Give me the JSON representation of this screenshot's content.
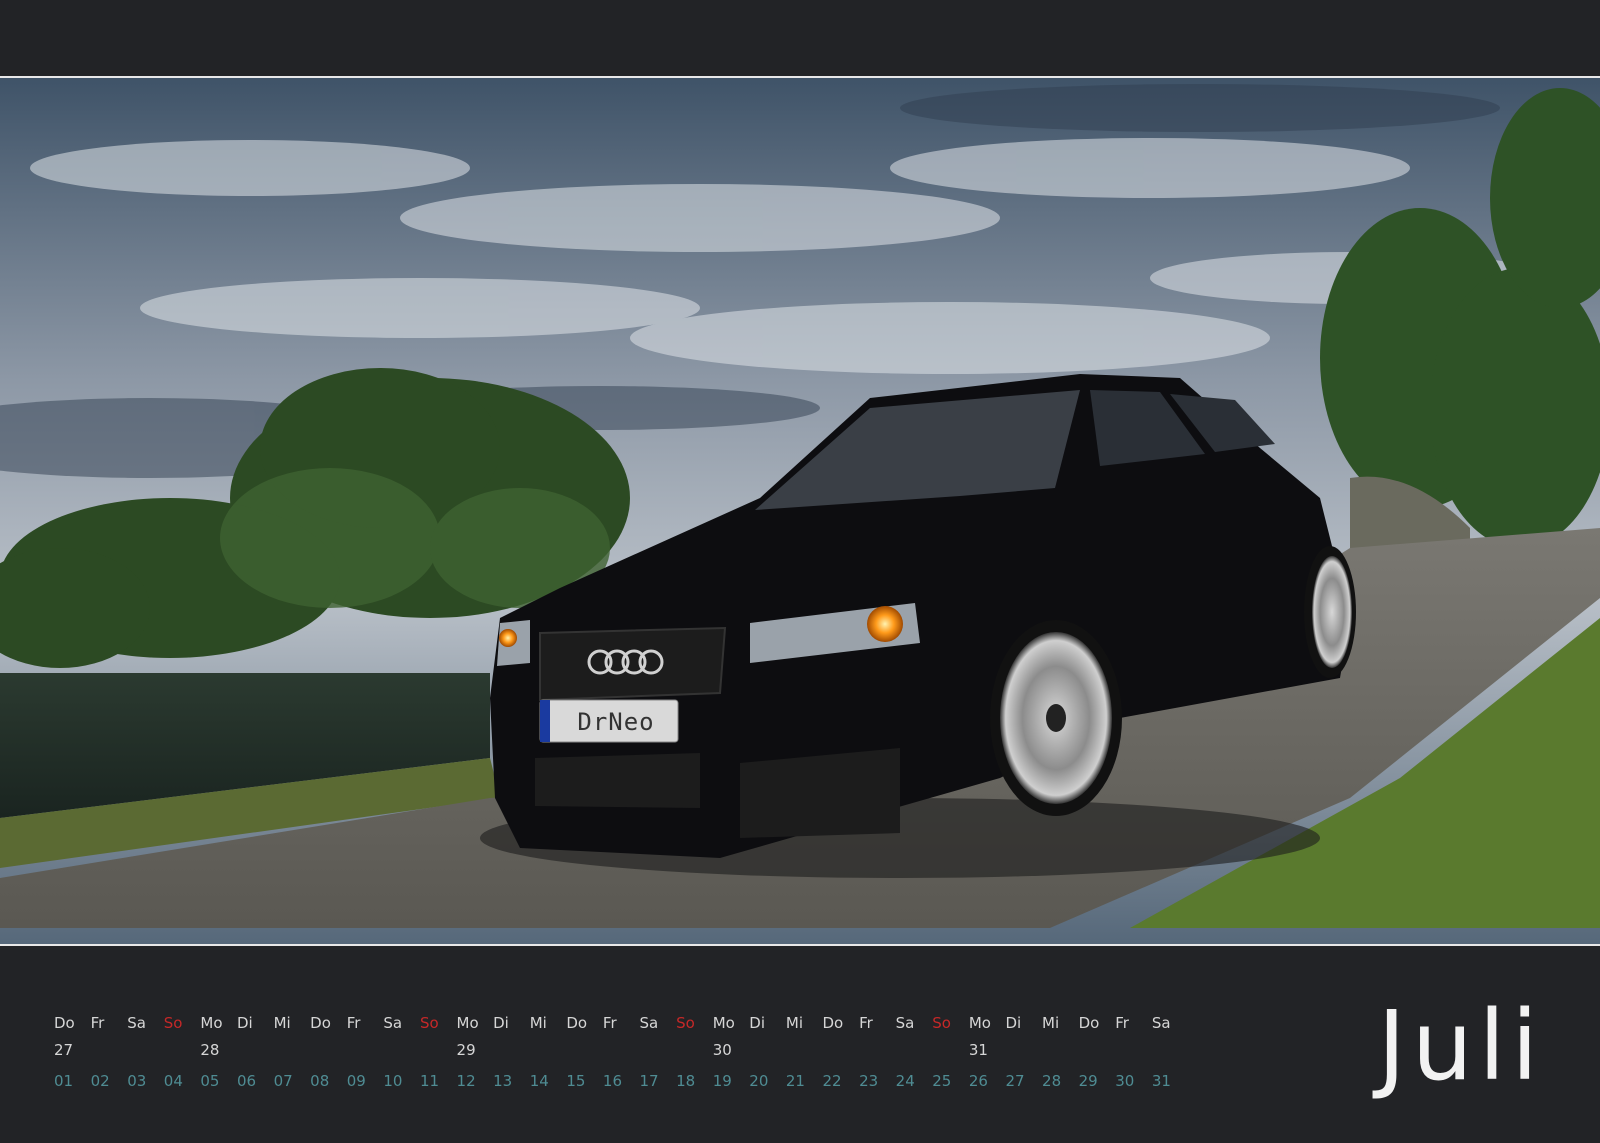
{
  "month": "Juli",
  "license_plate": "DrNeo",
  "weekdays": [
    "Do",
    "Fr",
    "Sa",
    "So",
    "Mo",
    "Di",
    "Mi",
    "Do",
    "Fr",
    "Sa",
    "So",
    "Mo",
    "Di",
    "Mi",
    "Do",
    "Fr",
    "Sa",
    "So",
    "Mo",
    "Di",
    "Mi",
    "Do",
    "Fr",
    "Sa",
    "So",
    "Mo",
    "Di",
    "Mi",
    "Do",
    "Fr",
    "Sa"
  ],
  "weeks": [
    {
      "col": 0,
      "label": "27"
    },
    {
      "col": 4,
      "label": "28"
    },
    {
      "col": 11,
      "label": "29"
    },
    {
      "col": 18,
      "label": "30"
    },
    {
      "col": 25,
      "label": "31"
    }
  ],
  "days": [
    "01",
    "02",
    "03",
    "04",
    "05",
    "06",
    "07",
    "08",
    "09",
    "10",
    "11",
    "12",
    "13",
    "14",
    "15",
    "16",
    "17",
    "18",
    "19",
    "20",
    "21",
    "22",
    "23",
    "24",
    "25",
    "26",
    "27",
    "28",
    "29",
    "30",
    "31"
  ],
  "colors": {
    "sunday": "#c62828",
    "day_number": "#4f8c93",
    "weekday": "#d6d6d6",
    "background": "#222326"
  }
}
